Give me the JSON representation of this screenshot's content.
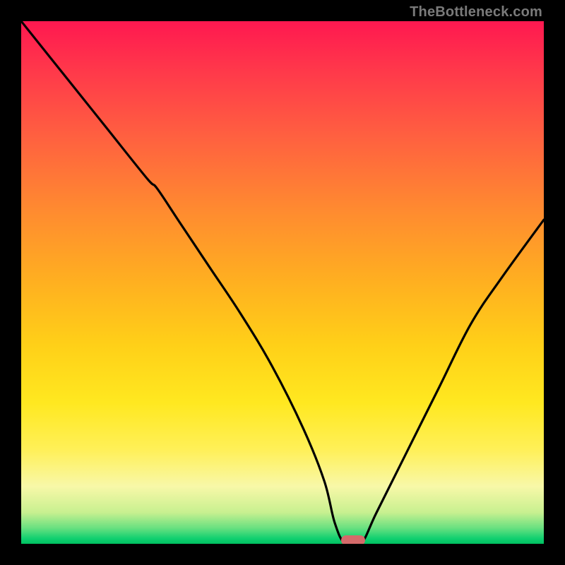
{
  "watermark": {
    "text": "TheBottleneck.com"
  },
  "colors": {
    "gradient_top": "#ff1850",
    "gradient_mid": "#ffe820",
    "gradient_bottom": "#00c060",
    "curve": "#000000",
    "marker": "#d46a6a",
    "frame": "#000000"
  },
  "chart_data": {
    "type": "line",
    "title": "",
    "xlabel": "",
    "ylabel": "",
    "xlim": [
      0,
      100
    ],
    "ylim": [
      0,
      100
    ],
    "grid": false,
    "legend_position": "none",
    "background": "red-yellow-green vertical gradient (bottleneck heat)",
    "series": [
      {
        "name": "bottleneck-curve",
        "x": [
          0,
          8,
          16,
          24,
          26,
          30,
          36,
          42,
          48,
          54,
          58,
          60,
          62,
          65,
          68,
          74,
          80,
          86,
          92,
          100
        ],
        "values": [
          100,
          90,
          80,
          70,
          68,
          62,
          53,
          44,
          34,
          22,
          12,
          4,
          0,
          0,
          6,
          18,
          30,
          42,
          51,
          62
        ]
      }
    ],
    "annotations": [
      {
        "name": "optimum-marker",
        "x": 63.5,
        "y": 0,
        "shape": "rounded-rect",
        "color": "#d46a6a"
      }
    ],
    "minimum_x": 63.5
  }
}
